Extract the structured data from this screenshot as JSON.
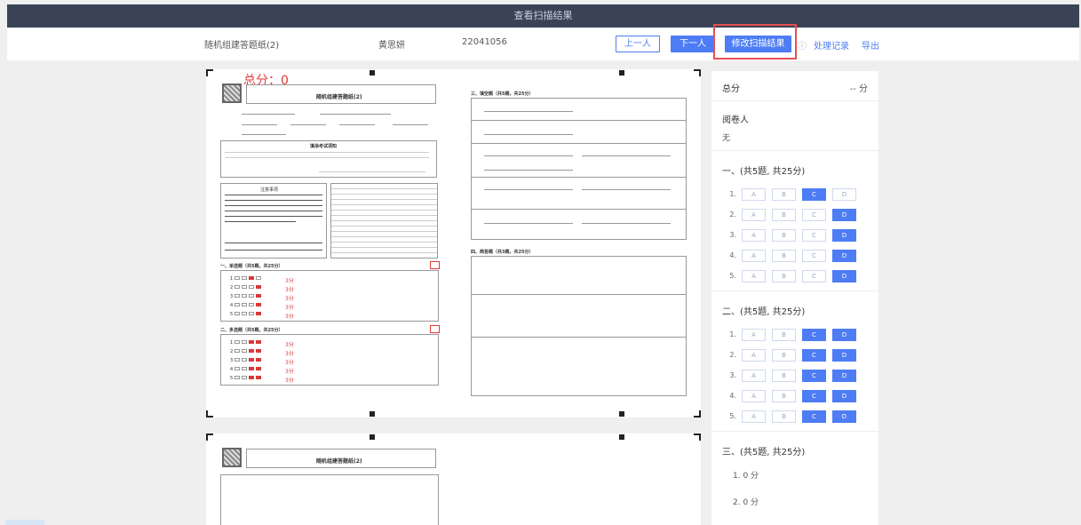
{
  "window": {
    "title": "查看扫描结果"
  },
  "info": {
    "paper_name": "随机组建答题纸(2)",
    "student_name": "黄思妍",
    "student_id": "22041056",
    "prev_label": "上一人",
    "next_label": "下一人",
    "edit_label": "修改扫描结果",
    "history_label": "处理记录",
    "export_label": "导出"
  },
  "sheet": {
    "total_score_label": "总分：0",
    "title": "随机组建答题纸(2)",
    "section_choice1": "一、单选题（共5题，共25分）",
    "section_choice2": "二、多选题（共5题，共25分）",
    "section_fill": "三、填空题（共5题，共25分）",
    "section_essay": "四、简答题（共3题，共25分）",
    "card_info_title": "填涂考试须知",
    "notes_title": "注意事项",
    "score_tag": "3分"
  },
  "panel": {
    "total_label": "总分",
    "total_value": "-- 分",
    "reviewer_label": "阅卷人",
    "reviewer_value": "无",
    "section1": {
      "title": "一、(共5题, 共25分)",
      "options": [
        "A",
        "B",
        "C",
        "D"
      ],
      "rows": [
        {
          "num": "1.",
          "selected": [
            "C"
          ]
        },
        {
          "num": "2.",
          "selected": [
            "D"
          ]
        },
        {
          "num": "3.",
          "selected": [
            "D"
          ]
        },
        {
          "num": "4.",
          "selected": [
            "D"
          ]
        },
        {
          "num": "5.",
          "selected": [
            "D"
          ]
        }
      ]
    },
    "section2": {
      "title": "二、(共5题, 共25分)",
      "options": [
        "A",
        "B",
        "C",
        "D"
      ],
      "rows": [
        {
          "num": "1.",
          "selected": [
            "C",
            "D"
          ]
        },
        {
          "num": "2.",
          "selected": [
            "C",
            "D"
          ]
        },
        {
          "num": "3.",
          "selected": [
            "C",
            "D"
          ]
        },
        {
          "num": "4.",
          "selected": [
            "C",
            "D"
          ]
        },
        {
          "num": "5.",
          "selected": [
            "C",
            "D"
          ]
        }
      ]
    },
    "section3": {
      "title": "三、(共5题, 共25分)",
      "rows": [
        {
          "num": "1.",
          "score": "0 分"
        },
        {
          "num": "2.",
          "score": "0 分"
        }
      ]
    }
  },
  "colors": {
    "topbar": "#3a4356",
    "accent": "#4d7cf5",
    "highlight": "#e55050",
    "mark": "#d83a3a"
  }
}
